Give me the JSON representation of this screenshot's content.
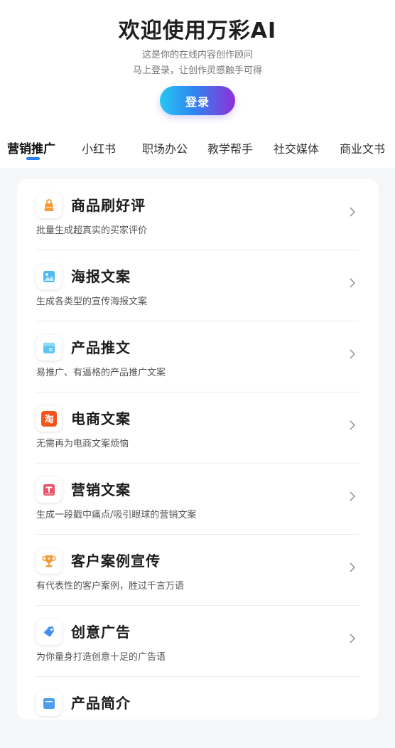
{
  "header": {
    "title": "欢迎使用万彩AI",
    "subtitle_line1": "这是你的在线内容创作顾问",
    "subtitle_line2": "马上登录，让创作灵感触手可得",
    "login_label": "登录"
  },
  "tabs": [
    {
      "label": "营销推广",
      "active": true
    },
    {
      "label": "小红书",
      "active": false
    },
    {
      "label": "职场办公",
      "active": false
    },
    {
      "label": "教学帮手",
      "active": false
    },
    {
      "label": "社交媒体",
      "active": false
    },
    {
      "label": "商业文书",
      "active": false
    }
  ],
  "items": [
    {
      "name": "商品刷好评",
      "desc": "批量生成超真实的买家评价",
      "icon": "shopping-bag-icon",
      "color": "#f59a3c"
    },
    {
      "name": "海报文案",
      "desc": "生成各类型的宣传海报文案",
      "icon": "image-icon",
      "color": "#52b8f2"
    },
    {
      "name": "产品推文",
      "desc": "易推广、有逼格的产品推广文案",
      "icon": "product-box-icon",
      "color": "#5cc4f0"
    },
    {
      "name": "电商文案",
      "desc": "无需再为电商文案烦恼",
      "icon": "taobao-icon",
      "glyph": "淘",
      "color": "#f5541c"
    },
    {
      "name": "营销文案",
      "desc": "生成一段戳中痛点/吸引眼球的营销文案",
      "icon": "text-doc-icon",
      "color": "#e8546a"
    },
    {
      "name": "客户案例宣传",
      "desc": "有代表性的客户案例，胜过千言万语",
      "icon": "trophy-icon",
      "color": "#f29a3a"
    },
    {
      "name": "创意广告",
      "desc": "为你量身打造创意十足的广告语",
      "icon": "tag-icon",
      "color": "#3f8ef2"
    },
    {
      "name": "产品简介",
      "desc": "",
      "icon": "product-intro-icon",
      "color": "#4a9cf0"
    }
  ]
}
